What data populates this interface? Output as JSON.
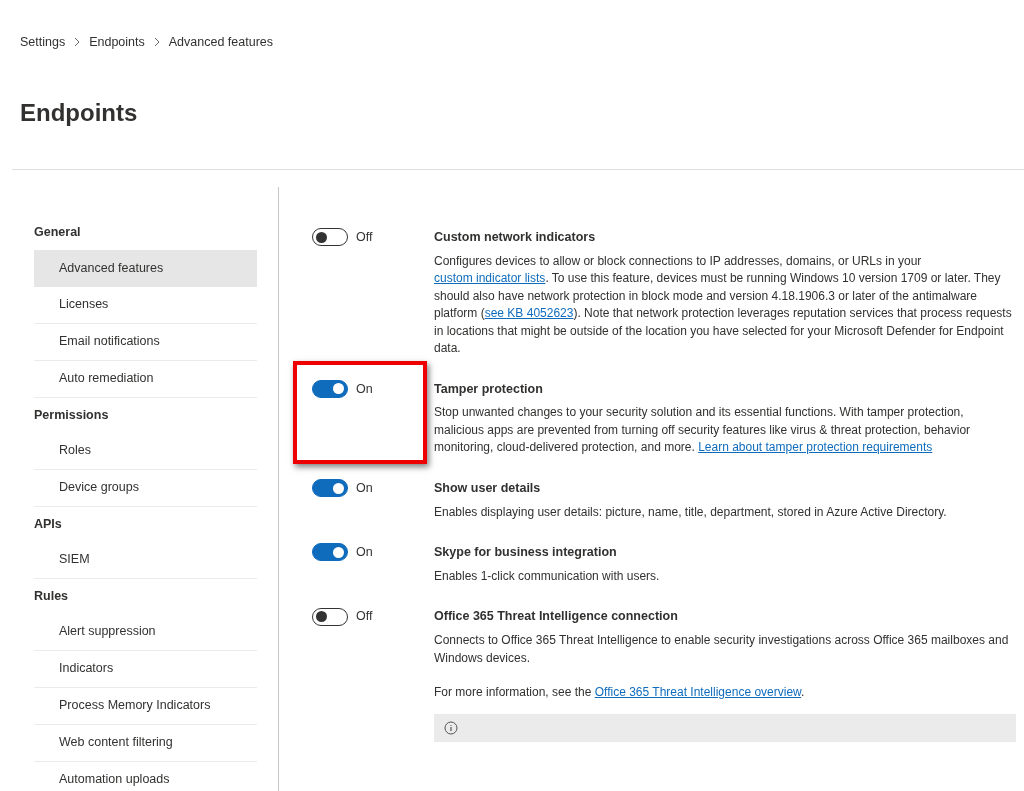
{
  "breadcrumb": [
    "Settings",
    "Endpoints",
    "Advanced features"
  ],
  "title": "Endpoints",
  "nav": [
    {
      "heading": "General",
      "items": [
        {
          "label": "Advanced features",
          "selected": true
        },
        {
          "label": "Licenses",
          "selected": false
        },
        {
          "label": "Email notifications",
          "selected": false
        },
        {
          "label": "Auto remediation",
          "selected": false
        }
      ]
    },
    {
      "heading": "Permissions",
      "items": [
        {
          "label": "Roles",
          "selected": false
        },
        {
          "label": "Device groups",
          "selected": false
        }
      ]
    },
    {
      "heading": "APIs",
      "items": [
        {
          "label": "SIEM",
          "selected": false
        }
      ]
    },
    {
      "heading": "Rules",
      "items": [
        {
          "label": "Alert suppression",
          "selected": false
        },
        {
          "label": "Indicators",
          "selected": false
        },
        {
          "label": "Process Memory Indicators",
          "selected": false
        },
        {
          "label": "Web content filtering",
          "selected": false
        },
        {
          "label": "Automation uploads",
          "selected": false
        }
      ]
    }
  ],
  "features": [
    {
      "on": false,
      "state_label": "Off",
      "title": "Custom network indicators",
      "highlighted": false,
      "info_bar": false,
      "paragraphs": [
        [
          {
            "kind": "text",
            "text": "Configures devices to allow or block connections to IP addresses, domains, or URLs in your "
          },
          {
            "kind": "link",
            "text": "custom indicator lists"
          },
          {
            "kind": "text",
            "text": ". To use this feature, devices must be running Windows 10 version 1709 or later. They should also have network protection in block mode and version 4.18.1906.3 or later of the antimalware platform ("
          },
          {
            "kind": "link",
            "text": "see KB 4052623"
          },
          {
            "kind": "text",
            "text": "). Note that network protection leverages reputation services that process requests in locations that might be outside of the location you have selected for your Microsoft Defender for Endpoint data."
          }
        ]
      ]
    },
    {
      "on": true,
      "state_label": "On",
      "title": "Tamper protection",
      "highlighted": true,
      "info_bar": false,
      "paragraphs": [
        [
          {
            "kind": "text",
            "text": "Stop unwanted changes to your security solution and its essential functions. With tamper protection, malicious apps are prevented from turning off security features like virus & threat protection, behavior monitoring, cloud-delivered protection, and more. "
          },
          {
            "kind": "link",
            "text": "Learn about tamper protection requirements"
          }
        ]
      ]
    },
    {
      "on": true,
      "state_label": "On",
      "title": "Show user details",
      "highlighted": false,
      "info_bar": false,
      "paragraphs": [
        [
          {
            "kind": "text",
            "text": "Enables displaying user details: picture, name, title, department, stored in Azure Active Directory."
          }
        ]
      ]
    },
    {
      "on": true,
      "state_label": "On",
      "title": "Skype for business integration",
      "highlighted": false,
      "info_bar": false,
      "paragraphs": [
        [
          {
            "kind": "text",
            "text": "Enables 1-click communication with users."
          }
        ]
      ]
    },
    {
      "on": false,
      "state_label": "Off",
      "title": "Office 365 Threat Intelligence connection",
      "highlighted": false,
      "info_bar": true,
      "paragraphs": [
        [
          {
            "kind": "text",
            "text": "Connects to Office 365 Threat Intelligence to enable security investigations across Office 365 mailboxes and Windows devices."
          }
        ],
        [
          {
            "kind": "text",
            "text": "For more information, see the "
          },
          {
            "kind": "link",
            "text": "Office 365 Threat Intelligence overview"
          },
          {
            "kind": "text",
            "text": "."
          }
        ]
      ]
    }
  ]
}
